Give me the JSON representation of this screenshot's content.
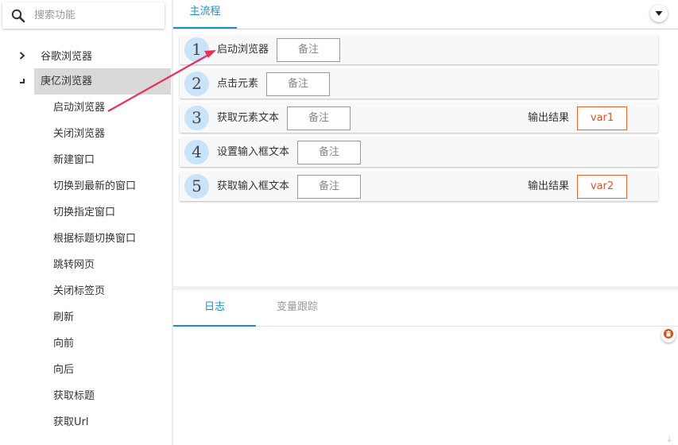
{
  "sidebar": {
    "search": {
      "placeholder": "搜索功能",
      "value": ""
    },
    "groups": [
      {
        "label": "谷歌浏览器",
        "expanded": false
      },
      {
        "label": "庚亿浏览器",
        "expanded": true
      }
    ],
    "sub_items": [
      "启动浏览器",
      "关闭浏览器",
      "新建窗口",
      "切换到最新的窗口",
      "切换指定窗口",
      "根据标题切换窗口",
      "跳转网页",
      "关闭标签页",
      "刷新",
      "向前",
      "向后",
      "获取标题",
      "获取Url"
    ]
  },
  "main": {
    "tab_label": "主流程",
    "steps": [
      {
        "num": "1",
        "title": "启动浏览器",
        "note": "备注"
      },
      {
        "num": "2",
        "title": "点击元素",
        "note": "备注"
      },
      {
        "num": "3",
        "title": "获取元素文本",
        "note": "备注",
        "output_label": "输出结果",
        "output_value": "var1"
      },
      {
        "num": "4",
        "title": "设置输入框文本",
        "note": "备注"
      },
      {
        "num": "5",
        "title": "获取输入框文本",
        "note": "备注",
        "output_label": "输出结果",
        "output_value": "var2"
      }
    ]
  },
  "log": {
    "tabs": [
      "日志",
      "变量跟踪"
    ],
    "active_tab": "日志"
  },
  "colors": {
    "accent": "#1890d0",
    "output": "#e8501a",
    "annotation_arrow": "#e8315a",
    "selected_group_bg": "#d9d9d9"
  }
}
